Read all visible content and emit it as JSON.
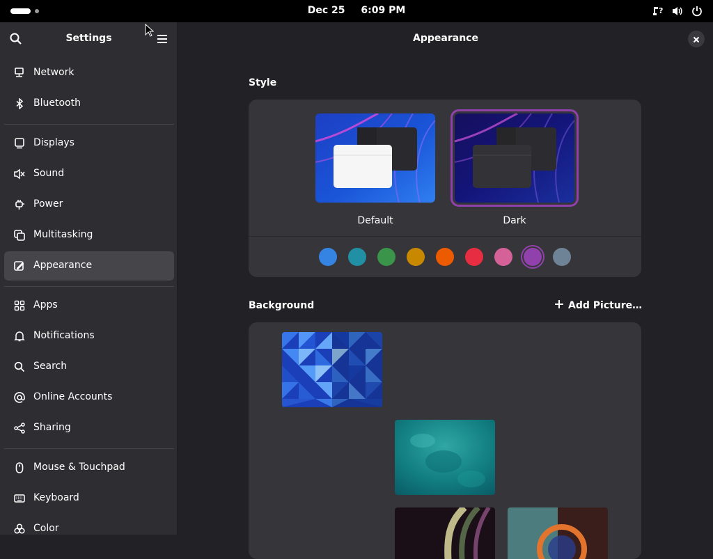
{
  "topbar": {
    "date": "Dec 25",
    "time": "6:09 PM",
    "tray_icons": [
      "network-question-icon",
      "volume-icon",
      "power-icon"
    ]
  },
  "sidebar": {
    "title": "Settings",
    "items": [
      {
        "label": "Network",
        "icon": "network-icon"
      },
      {
        "label": "Bluetooth",
        "icon": "bluetooth-icon"
      },
      {
        "label": "Displays",
        "icon": "display-icon"
      },
      {
        "label": "Sound",
        "icon": "speaker-icon"
      },
      {
        "label": "Power",
        "icon": "power-plug-icon"
      },
      {
        "label": "Multitasking",
        "icon": "multitasking-icon"
      },
      {
        "label": "Appearance",
        "icon": "appearance-icon",
        "active": true
      },
      {
        "label": "Apps",
        "icon": "apps-grid-icon"
      },
      {
        "label": "Notifications",
        "icon": "bell-icon"
      },
      {
        "label": "Search",
        "icon": "search-icon"
      },
      {
        "label": "Online Accounts",
        "icon": "at-sign-icon"
      },
      {
        "label": "Sharing",
        "icon": "share-icon"
      },
      {
        "label": "Mouse & Touchpad",
        "icon": "mouse-icon"
      },
      {
        "label": "Keyboard",
        "icon": "keyboard-icon"
      },
      {
        "label": "Color",
        "icon": "color-icon"
      }
    ]
  },
  "main": {
    "title": "Appearance",
    "style": {
      "section_title": "Style",
      "options": [
        {
          "label": "Default",
          "selected": false
        },
        {
          "label": "Dark",
          "selected": true
        }
      ],
      "accent_colors": [
        "#3584e4",
        "#2190a4",
        "#3a944a",
        "#c88800",
        "#ed5b00",
        "#e62d42",
        "#d56199",
        "#9141ac",
        "#6f8396"
      ],
      "selected_accent": "#9141ac"
    },
    "background": {
      "section_title": "Background",
      "add_picture_label": "Add Picture…"
    }
  }
}
